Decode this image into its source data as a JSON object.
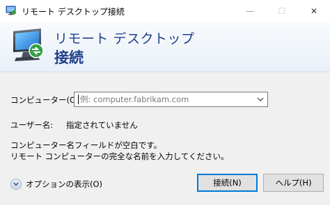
{
  "window": {
    "title": "リモート デスクトップ接続",
    "controls": {
      "minimize": "—",
      "maximize": "☐",
      "close": "✕"
    }
  },
  "header": {
    "line1": "リモート デスクトップ",
    "line2": "接続"
  },
  "form": {
    "computer_label": "コンピューター(C):",
    "computer_value": "",
    "computer_placeholder": "例: computer.fabrikam.com",
    "username_label": "ユーザー名:",
    "username_value": "指定されていません",
    "message_line1": "コンピューター名フィールドが空白です。",
    "message_line2": "リモート コンピューターの完全な名前を入力してください。"
  },
  "footer": {
    "options_label": "オプションの表示(O)",
    "connect_label": "接続(N)",
    "help_label": "ヘルプ(H)"
  },
  "colors": {
    "header_text": "#1e3f8c",
    "default_button_border": "#0078d7",
    "dialog_background": "#f0f0f0"
  },
  "icons": [
    "remote-desktop-app-icon",
    "remote-desktop-logo-icon",
    "chevron-down-icon",
    "expand-options-icon"
  ]
}
